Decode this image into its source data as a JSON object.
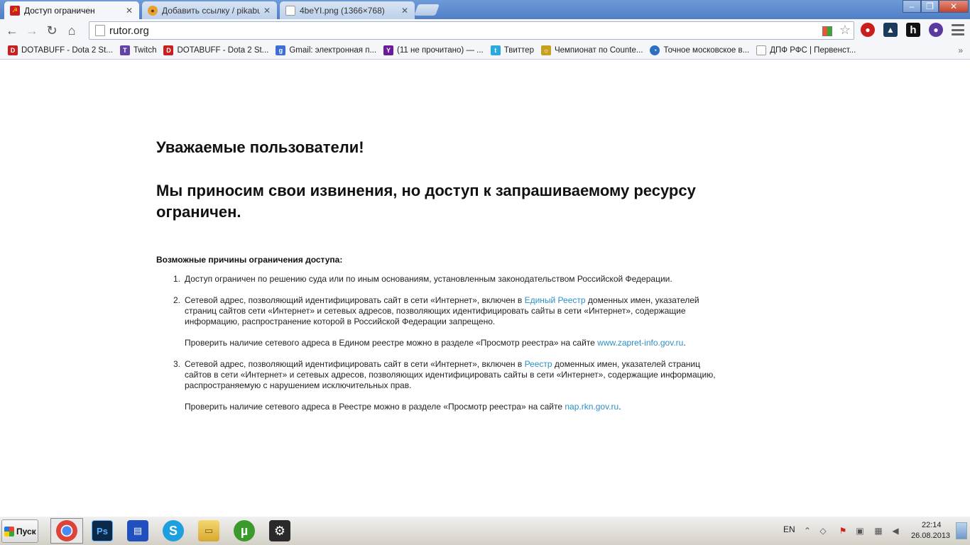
{
  "tabs": [
    {
      "label": "Доступ ограничен",
      "icon": "hammer-sickle-icon",
      "active": true
    },
    {
      "label": "Добавить ссылку / pikabu.ru",
      "icon": "pikabu-icon",
      "active": false
    },
    {
      "label": "4beYI.png (1366×768)",
      "icon": "page-icon",
      "active": false
    }
  ],
  "toolbar": {
    "url": "rutor.org",
    "back": "←",
    "forward": "→",
    "reload": "↻",
    "home": "⌂",
    "star": "☆",
    "menu_icon": "menu-icon"
  },
  "window_controls": {
    "minimize": "–",
    "maximize": "❐",
    "close": "✕"
  },
  "bookmarks": [
    {
      "label": "DOTABUFF - Dota 2 St...",
      "icon": "dotabuff-icon",
      "color": "#c82020",
      "glyph": "D"
    },
    {
      "label": "Twitch",
      "icon": "twitch-icon",
      "color": "#6441a5",
      "glyph": "T"
    },
    {
      "label": "DOTABUFF - Dota 2 St...",
      "icon": "dotabuff-icon",
      "color": "#c82020",
      "glyph": "D"
    },
    {
      "label": "Gmail: электронная п...",
      "icon": "google-icon",
      "color": "#3b6fd6",
      "glyph": "g"
    },
    {
      "label": "(11 не прочитано) — ...",
      "icon": "yahoo-icon",
      "color": "#6a1b9a",
      "glyph": "Y"
    },
    {
      "label": "Твиттер",
      "icon": "twitter-icon",
      "color": "#2aa9e0",
      "glyph": "t"
    },
    {
      "label": "Чемпионат по Counte...",
      "icon": "lion-icon",
      "color": "#c8a020",
      "glyph": "☼"
    },
    {
      "label": "Точное московское в...",
      "icon": "clock-icon",
      "color": "#2e6fbf",
      "glyph": "◔"
    },
    {
      "label": "ДПФ РФС | Первенст...",
      "icon": "page-icon",
      "color": "#ffffff",
      "glyph": ""
    }
  ],
  "bookmarks_more": "»",
  "page": {
    "heading1": "Уважаемые пользователи!",
    "heading2": "Мы приносим свои извинения, но доступ к запрашиваемому ресурсу ограничен.",
    "reasons_heading": "Возможные причины ограничения доступа:",
    "reasons": [
      {
        "num": "1.",
        "text": "Доступ ограничен  по решению суда или по иным основаниям, установленным законодательством Российской Федерации."
      },
      {
        "num": "2.",
        "text_before": "Сетевой адрес, позволяющий идентифицировать сайт в сети «Интернет», включен в ",
        "link": "Единый Реестр",
        "text_after": " доменных имен, указателей страниц сайтов сети «Интернет» и сетевых адресов, позволяющих идентифицировать сайты в сети «Интернет», содержащие информацию, распространение которой в Российской Федерации запрещено.",
        "check_before": "Проверить наличие сетевого адреса в Едином реестре можно в разделе «Просмотр реестра» на сайте ",
        "check_link": "www.zapret-info.gov.ru",
        "check_after": "."
      },
      {
        "num": "3.",
        "text_before": "Сетевой адрес, позволяющий идентифицировать сайт в сети «Интернет», включен в ",
        "link": "Реестр",
        "text_after": " доменных имен, указателей страниц сайтов в сети «Интернет» и сетевых адресов, позволяющих идентифицировать сайты в сети «Интернет», содержащие информацию, распространяемую с нарушением исключительных прав.",
        "check_before": "Проверить наличие сетевого адреса в Реестре можно в разделе «Просмотр реестра» на сайте ",
        "check_link": "nap.rkn.gov.ru",
        "check_after": "."
      }
    ]
  },
  "taskbar": {
    "start_label": "Пуск",
    "apps": [
      {
        "name": "chrome",
        "glyph": "◉",
        "color": "#db4437",
        "active": true
      },
      {
        "name": "photoshop",
        "glyph": "Ps",
        "color": "#0b2a4a",
        "active": false
      },
      {
        "name": "save",
        "glyph": "▤",
        "color": "#2050c0",
        "active": false
      },
      {
        "name": "skype",
        "glyph": "S",
        "color": "#1ea0e0",
        "active": false
      },
      {
        "name": "explorer",
        "glyph": "▭",
        "color": "#e8c050",
        "active": false
      },
      {
        "name": "utorrent",
        "glyph": "µ",
        "color": "#3a9a2a",
        "active": false
      },
      {
        "name": "steam",
        "glyph": "⚙",
        "color": "#2a2a2a",
        "active": false
      }
    ],
    "lang": "EN",
    "time": "22:14",
    "date": "26.08.2013"
  },
  "colors": {
    "link": "#2b8fc7",
    "titlebar": "#5a88cc"
  }
}
